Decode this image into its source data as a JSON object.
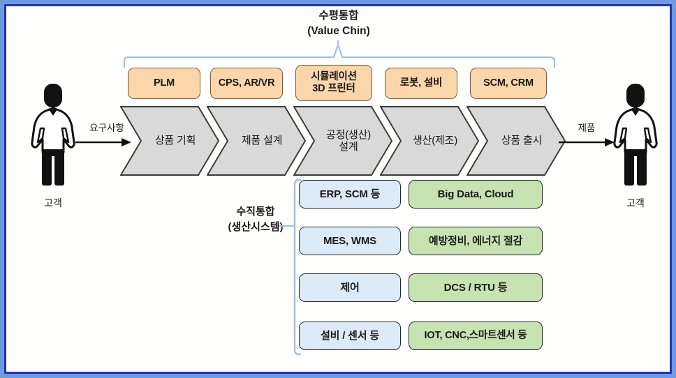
{
  "diagram": {
    "title_top": {
      "line1": "수평통합",
      "line2": "(Value Chin)"
    },
    "title_side": {
      "line1": "수직통합",
      "line2": "(생산시스템)"
    },
    "actors": {
      "left": {
        "label": "고객",
        "icon": "person-icon"
      },
      "right": {
        "label": "고객",
        "icon": "person-icon"
      }
    },
    "flow_arrows": {
      "input_label": "요구사항",
      "output_label": "제품"
    },
    "enabler_boxes": [
      {
        "id": "plm",
        "label": "PLM",
        "color": "#fbd6ab"
      },
      {
        "id": "cps-arvr",
        "label": "CPS, AR/VR",
        "color": "#fbd6ab"
      },
      {
        "id": "simulation-3dprinter",
        "label": "시뮬레이션\n3D 프린터",
        "color": "#fbd6ab"
      },
      {
        "id": "robot-facility",
        "label": "로봇, 설비",
        "color": "#fbd6ab"
      },
      {
        "id": "scm-crm",
        "label": "SCM, CRM",
        "color": "#fbd6ab"
      }
    ],
    "process_steps": [
      {
        "id": "product-planning",
        "label": "상품 기획"
      },
      {
        "id": "product-design",
        "label": "제품 설계"
      },
      {
        "id": "process-design",
        "label": "공정(생산)\n설계"
      },
      {
        "id": "production",
        "label": "생산(제조)"
      },
      {
        "id": "product-launch",
        "label": "상품 출시"
      }
    ],
    "vertical_layers": [
      {
        "level": 1,
        "system": {
          "id": "erp-scm",
          "label": "ERP, SCM 등",
          "color": "#ddeaf7"
        },
        "tech": {
          "id": "bigdata-cloud",
          "label": "Big Data, Cloud",
          "color": "#c7e3b2"
        }
      },
      {
        "level": 2,
        "system": {
          "id": "mes-wms",
          "label": "MES, WMS",
          "color": "#ddeaf7"
        },
        "tech": {
          "id": "preventive-energy",
          "label": "예방정비, 에너지 절감",
          "color": "#c7e3b2"
        }
      },
      {
        "level": 3,
        "system": {
          "id": "control",
          "label": "제어",
          "color": "#ddeaf7"
        },
        "tech": {
          "id": "dcs-rtu",
          "label": "DCS / RTU 등",
          "color": "#c7e3b2"
        }
      },
      {
        "level": 4,
        "system": {
          "id": "facility-sensor",
          "label": "설비 / 센서 등",
          "color": "#ddeaf7"
        },
        "tech": {
          "id": "iot-cnc-smartsensor",
          "label": "IOT, CNC,스마트센서 등",
          "color": "#c7e3b2"
        }
      }
    ],
    "colors": {
      "frame_border": "#1f33b5",
      "outer_background": "#6f9ade",
      "canvas_background": "#fffffd",
      "chevron_fill": "#d9d9d9",
      "chevron_border": "#3c3c3c",
      "bracket": "#9dc3e6",
      "orange": "#fbd6ab",
      "blue": "#ddeaf7",
      "green": "#c7e3b2"
    }
  }
}
